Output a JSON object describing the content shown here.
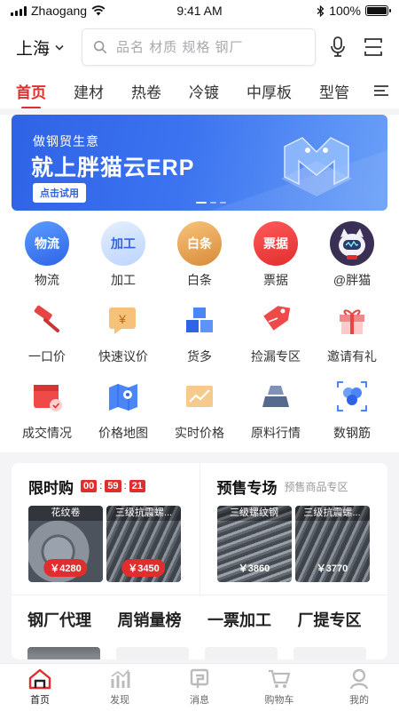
{
  "status": {
    "carrier": "Zhaogang",
    "time": "9:41 AM",
    "battery": "100%"
  },
  "header": {
    "city": "上海",
    "search_placeholder": "品名 材质 规格 钢厂",
    "icons": [
      "microphone-icon",
      "scan-icon"
    ]
  },
  "categories": [
    "首页",
    "建材",
    "热卷",
    "冷镀",
    "中厚板",
    "型管"
  ],
  "active_category": 0,
  "banner": {
    "line1": "做钢贸生意",
    "line2": "就上胖猫云ERP",
    "button": "点击试用",
    "slides": 3,
    "active_slide": 0,
    "colors": {
      "from": "#2f63e6",
      "to": "#6aa0f8"
    }
  },
  "services": [
    {
      "label": "物流",
      "badge": "物流",
      "icon": "logistics-icon"
    },
    {
      "label": "加工",
      "badge": "加工",
      "icon": "processing-icon"
    },
    {
      "label": "白条",
      "badge": "白条",
      "icon": "credit-icon"
    },
    {
      "label": "票据",
      "badge": "票据",
      "icon": "bill-icon"
    },
    {
      "label": "@胖猫",
      "badge": "",
      "icon": "panmao-robot-icon"
    },
    {
      "label": "一口价",
      "icon": "gavel-icon"
    },
    {
      "label": "快速议价",
      "icon": "bargain-icon"
    },
    {
      "label": "货多",
      "icon": "boxes-icon"
    },
    {
      "label": "捡漏专区",
      "icon": "price-tag-icon"
    },
    {
      "label": "邀请有礼",
      "icon": "gift-icon"
    },
    {
      "label": "成交情况",
      "icon": "deal-calendar-icon"
    },
    {
      "label": "价格地图",
      "icon": "map-pin-icon"
    },
    {
      "label": "实时价格",
      "icon": "trend-chart-icon"
    },
    {
      "label": "原料行情",
      "icon": "raw-material-icon"
    },
    {
      "label": "数钢筋",
      "icon": "rebar-count-icon"
    }
  ],
  "flash_sale": {
    "title": "限时购",
    "countdown": {
      "h": "00",
      "m": "59",
      "s": "21",
      "sep": ":"
    },
    "items": [
      {
        "label": "花纹卷",
        "price": "￥4280"
      },
      {
        "label": "三级抗震螺...",
        "price": "￥3450"
      }
    ]
  },
  "presale": {
    "title": "预售专场",
    "subtitle": "预售商品专区",
    "items": [
      {
        "label": "三级螺纹钢",
        "price": "￥3860"
      },
      {
        "label": "三级抗震螺...",
        "price": "￥3770"
      }
    ]
  },
  "sections": [
    "钢厂代理",
    "周销量榜",
    "一票加工",
    "厂提专区"
  ],
  "tab_bar": [
    {
      "label": "首页",
      "icon": "home-icon"
    },
    {
      "label": "发现",
      "icon": "discover-icon"
    },
    {
      "label": "消息",
      "icon": "message-icon"
    },
    {
      "label": "购物车",
      "icon": "cart-icon"
    },
    {
      "label": "我的",
      "icon": "profile-icon"
    }
  ],
  "accent": "#e02e2e"
}
